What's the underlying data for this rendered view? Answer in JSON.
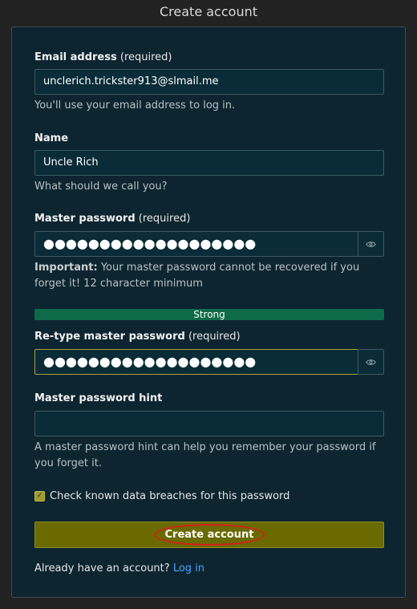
{
  "title": "Create account",
  "email": {
    "label": "Email address",
    "required": "(required)",
    "value": "unclerich.trickster913@slmail.me",
    "help": "You'll use your email address to log in."
  },
  "name": {
    "label": "Name",
    "value": "Uncle Rich",
    "help": "What should we call you?"
  },
  "master_password": {
    "label": "Master password",
    "required": "(required)",
    "value": "●●●●●●●●●●●●●●●●●●●",
    "help_strong": "Important:",
    "help": " Your master password cannot be recovered if you forget it! 12 character minimum",
    "strength": "Strong"
  },
  "retype_password": {
    "label": "Re-type master password",
    "required": "(required)",
    "value": "●●●●●●●●●●●●●●●●●●●"
  },
  "hint": {
    "label": "Master password hint",
    "value": "",
    "help": "A master password hint can help you remember your password if you forget it."
  },
  "breach_check": {
    "label": "Check known data breaches for this password",
    "checked": true
  },
  "submit_label": "Create account",
  "login_prompt": "Already have an account?",
  "login_link": "Log in",
  "colors": {
    "background": "#222222",
    "card": "#0d2530",
    "button": "#6a6a00",
    "strength_bar": "#0e6b4a",
    "link": "#4aa3ff",
    "highlight": "#d42020"
  }
}
